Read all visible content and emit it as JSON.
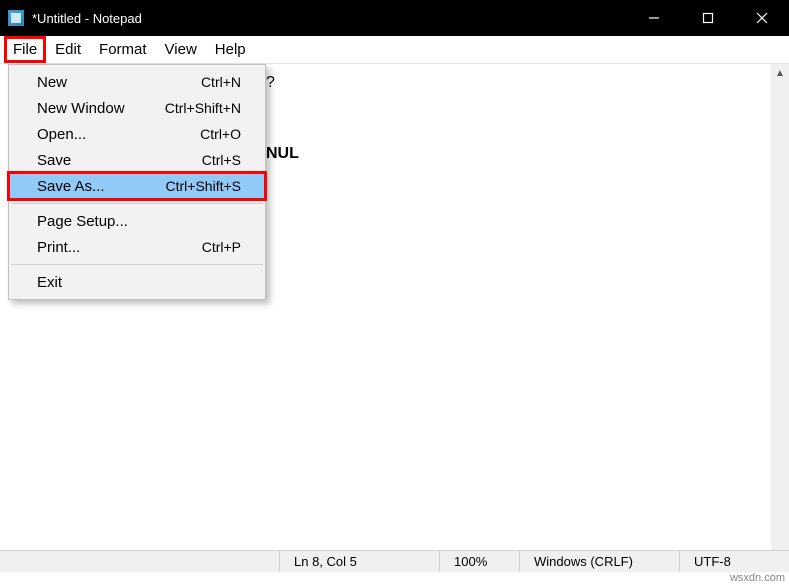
{
  "titlebar": {
    "title": "*Untitled - Notepad"
  },
  "menubar": {
    "items": [
      "File",
      "Edit",
      "Format",
      "View",
      "Help"
    ],
    "highlighted_index": 0
  },
  "dropdown": {
    "items": [
      {
        "label": "New",
        "shortcut": "Ctrl+N"
      },
      {
        "label": "New Window",
        "shortcut": "Ctrl+Shift+N"
      },
      {
        "label": "Open...",
        "shortcut": "Ctrl+O"
      },
      {
        "label": "Save",
        "shortcut": "Ctrl+S"
      },
      {
        "label": "Save As...",
        "shortcut": "Ctrl+Shift+S",
        "selected": true
      },
      {
        "sep": true
      },
      {
        "label": "Page Setup...",
        "shortcut": ""
      },
      {
        "label": "Print...",
        "shortcut": "Ctrl+P"
      },
      {
        "sep": true
      },
      {
        "label": "Exit",
        "shortcut": ""
      }
    ]
  },
  "editor": {
    "line1_suffix": "?",
    "nul_text": "NUL"
  },
  "statusbar": {
    "position": "Ln 8, Col 5",
    "zoom": "100%",
    "line_ending": "Windows (CRLF)",
    "encoding": "UTF-8"
  },
  "watermark": "wsxdn.com"
}
